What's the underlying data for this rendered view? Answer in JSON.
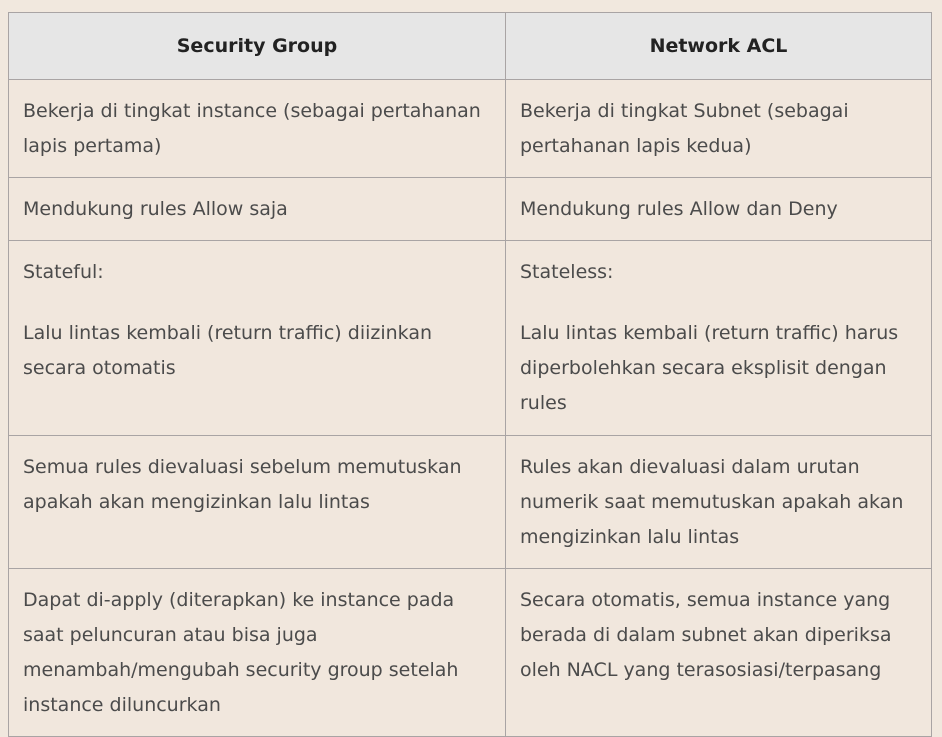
{
  "table": {
    "headers": [
      "Security Group",
      "Network ACL"
    ],
    "rows": [
      {
        "security_group": [
          "Bekerja di tingkat instance (sebagai pertahanan lapis pertama)"
        ],
        "network_acl": [
          "Bekerja di tingkat Subnet (sebagai pertahanan lapis kedua)"
        ]
      },
      {
        "security_group": [
          "Mendukung rules Allow saja"
        ],
        "network_acl": [
          "Mendukung rules Allow dan Deny"
        ]
      },
      {
        "security_group": [
          "Stateful:",
          "Lalu lintas kembali (return traffic) diizinkan secara otomatis"
        ],
        "network_acl": [
          "Stateless:",
          "Lalu lintas kembali (return traffic) harus diperbolehkan secara eksplisit dengan rules"
        ]
      },
      {
        "security_group": [
          "Semua rules dievaluasi sebelum memutuskan apakah akan mengizinkan lalu lintas"
        ],
        "network_acl": [
          "Rules akan dievaluasi dalam urutan numerik saat memutuskan apakah akan mengizinkan lalu lintas"
        ]
      },
      {
        "security_group": [
          "Dapat di-apply (diterapkan) ke instance pada saat peluncuran atau bisa juga menambah/mengubah security group setelah instance diluncurkan"
        ],
        "network_acl": [
          "Secara otomatis, semua instance yang berada di dalam subnet akan diperiksa oleh NACL yang terasosiasi/terpasang"
        ]
      }
    ]
  },
  "colors": {
    "header_bg": "#e6e6e6",
    "cell_bg": "#f1e7dd",
    "border": "#a9a4a4",
    "text": "#4b4b4b",
    "header_text": "#222222"
  }
}
